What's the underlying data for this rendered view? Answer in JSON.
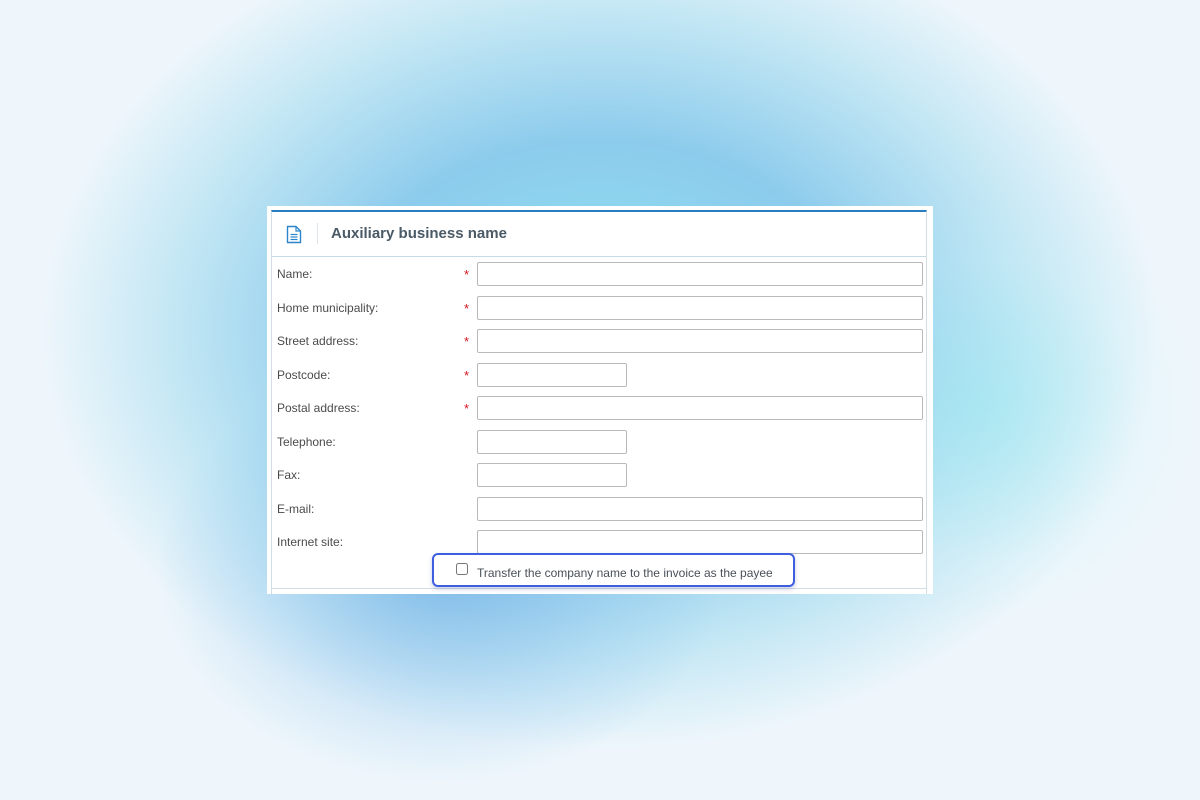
{
  "panel": {
    "title": "Auxiliary business name",
    "header_icon": "document-icon"
  },
  "form": {
    "required_marker": "*",
    "fields": [
      {
        "label": "Name:",
        "required": true,
        "value": ""
      },
      {
        "label": "Home municipality:",
        "required": true,
        "value": ""
      },
      {
        "label": "Street address:",
        "required": true,
        "value": ""
      },
      {
        "label": "Postcode:",
        "required": true,
        "value": ""
      },
      {
        "label": "Postal address:",
        "required": true,
        "value": ""
      },
      {
        "label": "Telephone:",
        "required": false,
        "value": ""
      },
      {
        "label": "Fax:",
        "required": false,
        "value": ""
      },
      {
        "label": "E-mail:",
        "required": false,
        "value": ""
      },
      {
        "label": "Internet site:",
        "required": false,
        "value": ""
      }
    ]
  },
  "checkbox": {
    "label": "Transfer the company name to the invoice as the payee",
    "checked": false
  },
  "colors": {
    "accent": "#2a7ec0",
    "required": "#d2141e",
    "highlight": "#3e5ee0"
  }
}
